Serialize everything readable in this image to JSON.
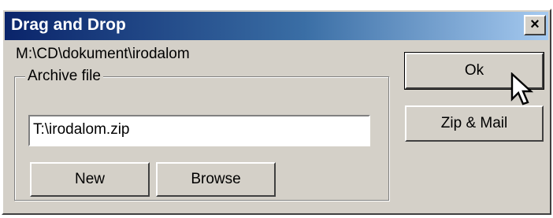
{
  "window": {
    "title": "Drag and Drop",
    "close_glyph": "×",
    "close_icon": "close-icon"
  },
  "path_text": "M:\\CD\\dokument\\irodalom",
  "archive_group": {
    "label": "Archive file",
    "input_value": "T:\\irodalom.zip"
  },
  "buttons": {
    "new": "New",
    "browse": "Browse",
    "ok": "Ok",
    "zip_mail": "Zip & Mail"
  },
  "cursor_icon": "arrow-pointer-icon",
  "colors": {
    "face": "#d4d0c8",
    "title_start": "#0a246a",
    "title_end": "#a6caf0"
  }
}
